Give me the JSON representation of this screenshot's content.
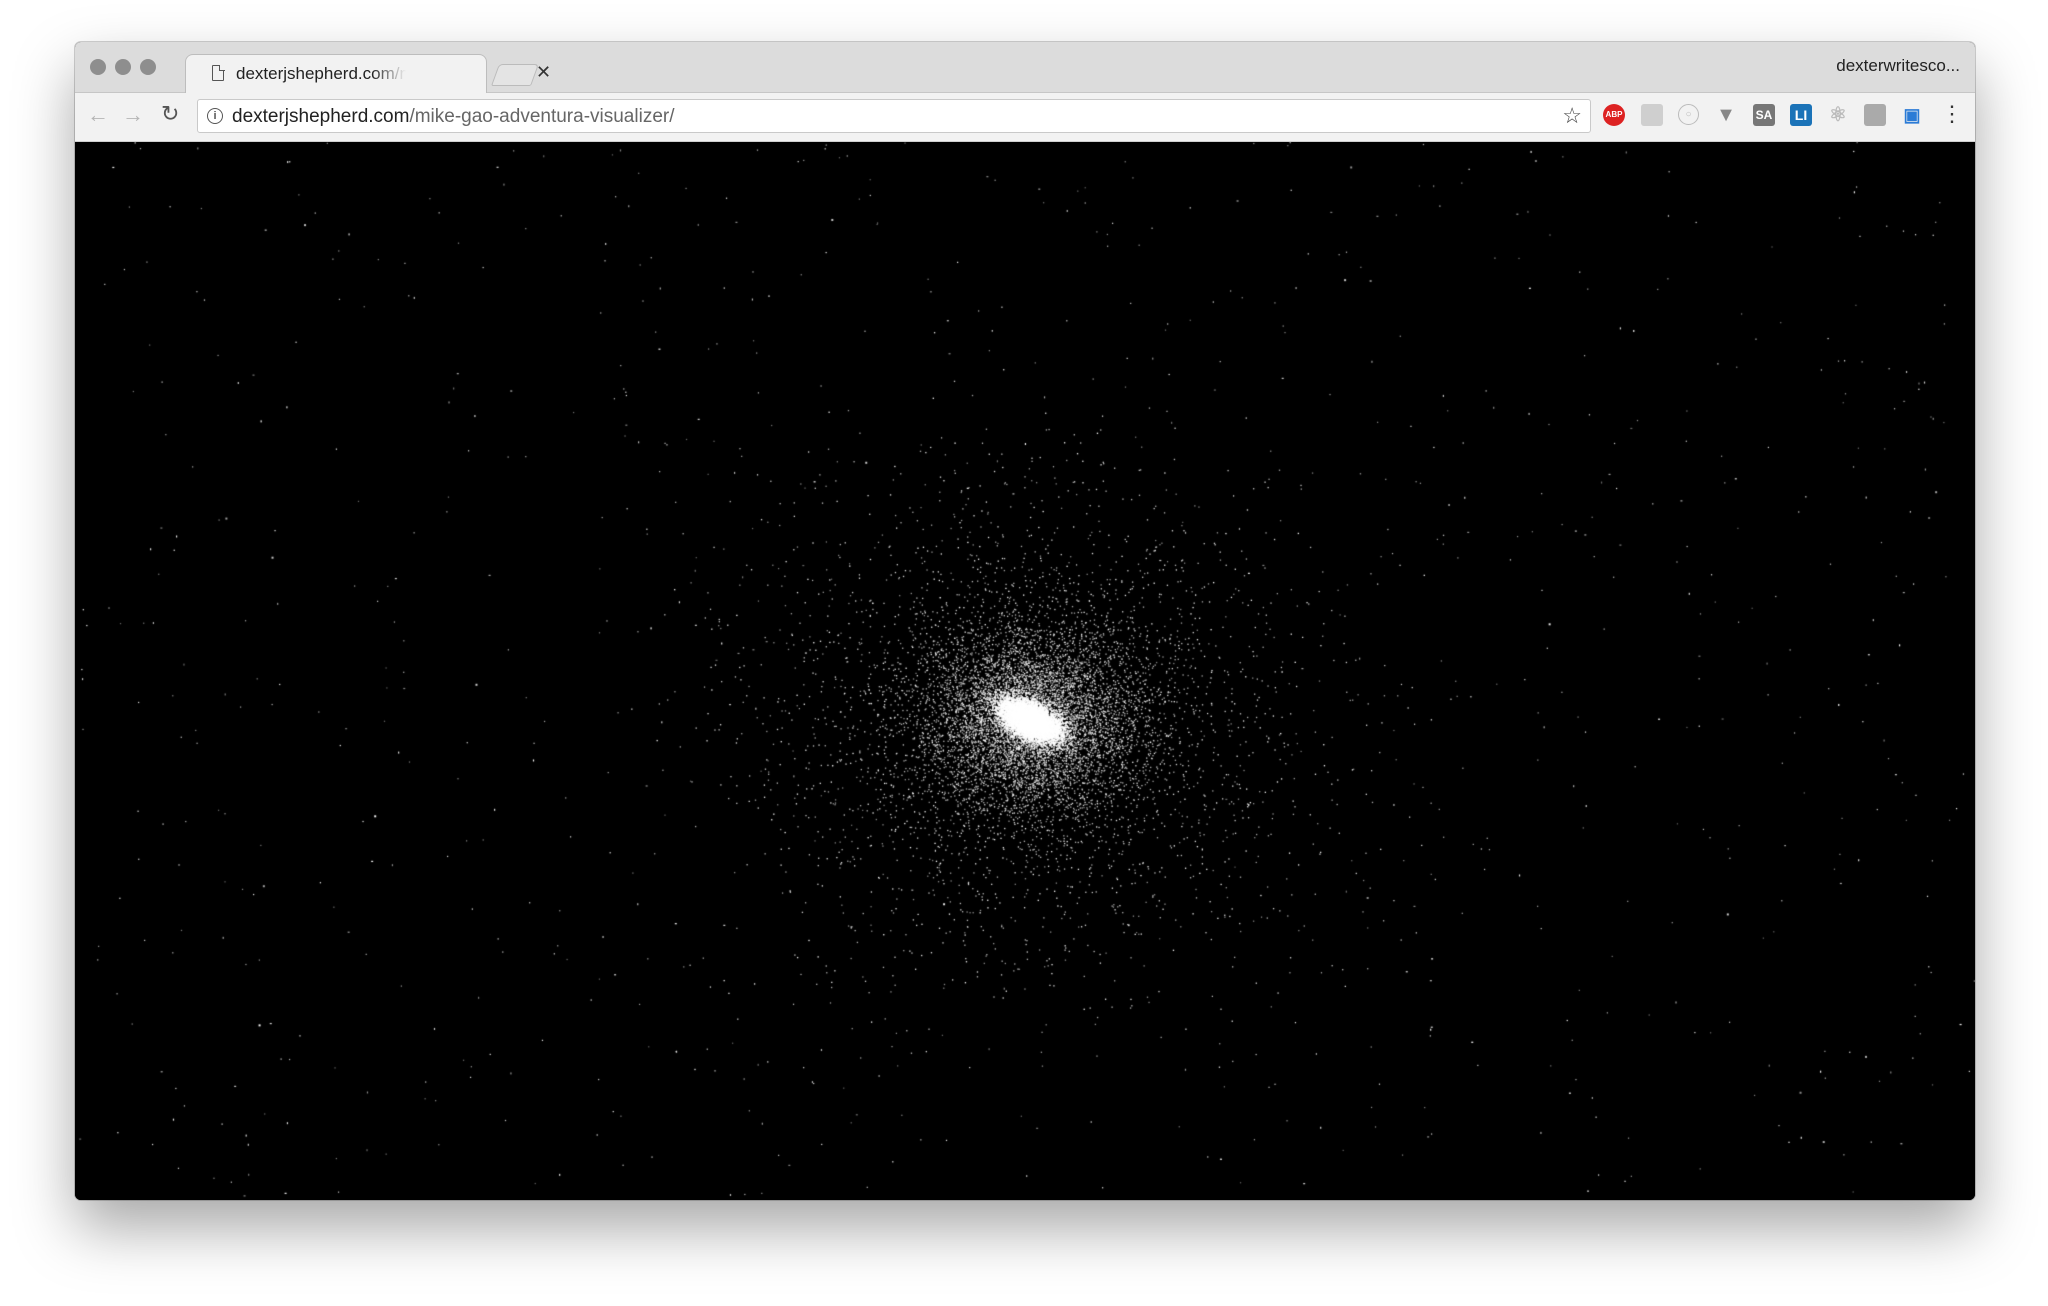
{
  "tab": {
    "title": "dexterjshepherd.com/mike-gao-adventura-visualizer/",
    "audio_icon": "speaker-icon",
    "close_icon": "close-icon"
  },
  "profile": {
    "name": "dexterwritesco..."
  },
  "address_bar": {
    "domain": "dexterjshepherd.com",
    "path": "/mike-gao-adventura-visualizer/"
  },
  "extensions": {
    "abp": "ABP",
    "sa": "SA",
    "li": "LI"
  },
  "colors": {
    "page_background": "#000000",
    "particle": "#ffffff",
    "abp_red": "#dd2222",
    "li_blue": "#1b73b8",
    "cast_blue": "#2b7bd6"
  }
}
